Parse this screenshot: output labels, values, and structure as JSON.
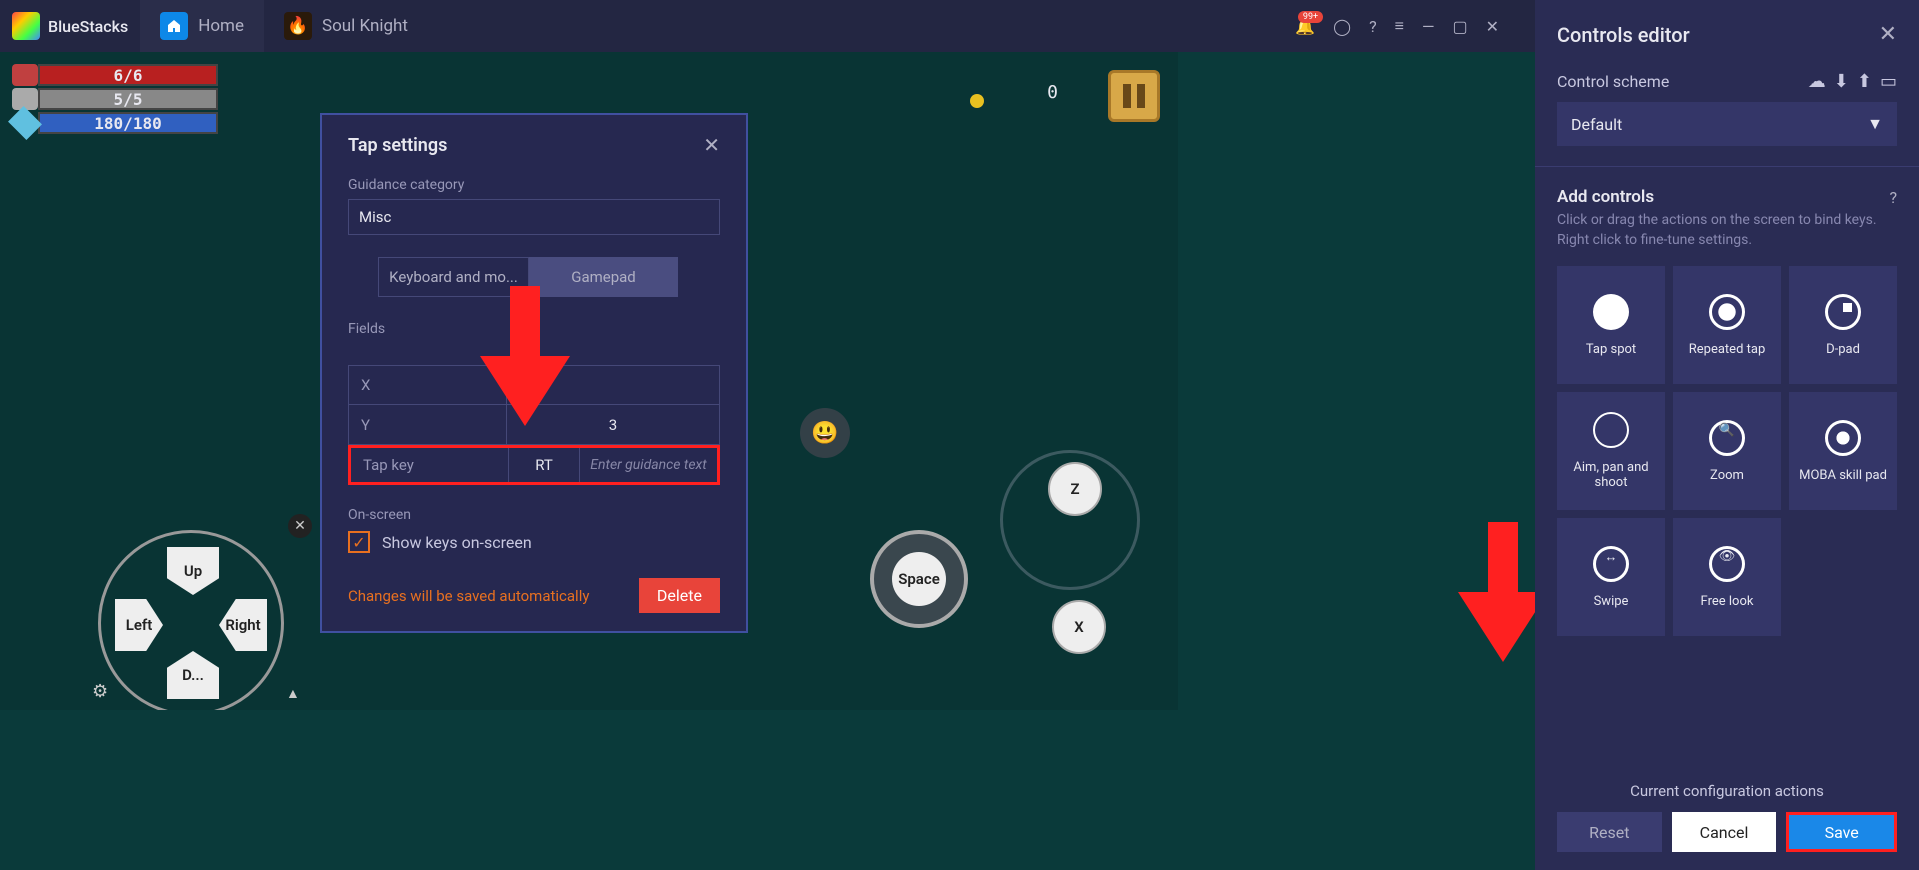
{
  "titlebar": {
    "logo": "BlueStacks",
    "tabs": {
      "home": "Home",
      "game": "Soul Knight"
    },
    "notif_badge": "99+"
  },
  "hud": {
    "hp": "6/6",
    "shield": "5/5",
    "mana": "180/180",
    "counter": "0"
  },
  "dialog": {
    "title": "Tap settings",
    "guidance_label": "Guidance category",
    "guidance_value": "Misc",
    "tab_keyboard": "Keyboard and mo...",
    "tab_gamepad": "Gamepad",
    "fields_label": "Fields",
    "rows": {
      "x": {
        "label": "X",
        "value": ""
      },
      "y": {
        "label": "Y",
        "value": "3"
      },
      "tapkey": {
        "label": "Tap key",
        "value": "RT",
        "guidance": "Enter guidance text"
      }
    },
    "onscreen_label": "On-screen",
    "show_keys": "Show keys on-screen",
    "auto_save": "Changes will be saved automatically",
    "delete": "Delete"
  },
  "dpad": {
    "up": "Up",
    "down": "D...",
    "left": "Left",
    "right": "Right"
  },
  "actions": {
    "z": "Z",
    "x": "X",
    "space": "Space"
  },
  "panel": {
    "title": "Controls editor",
    "scheme_label": "Control scheme",
    "scheme_value": "Default",
    "add_title": "Add controls",
    "add_desc": "Click or drag the actions on the screen to bind keys. Right click to fine-tune settings.",
    "controls": {
      "tapspot": "Tap spot",
      "repeated": "Repeated tap",
      "dpad": "D-pad",
      "aim": "Aim, pan and shoot",
      "zoom": "Zoom",
      "moba": "MOBA skill pad",
      "swipe": "Swipe",
      "freelook": "Free look"
    },
    "config_text": "Current configuration actions",
    "reset": "Reset",
    "cancel": "Cancel",
    "save": "Save"
  }
}
